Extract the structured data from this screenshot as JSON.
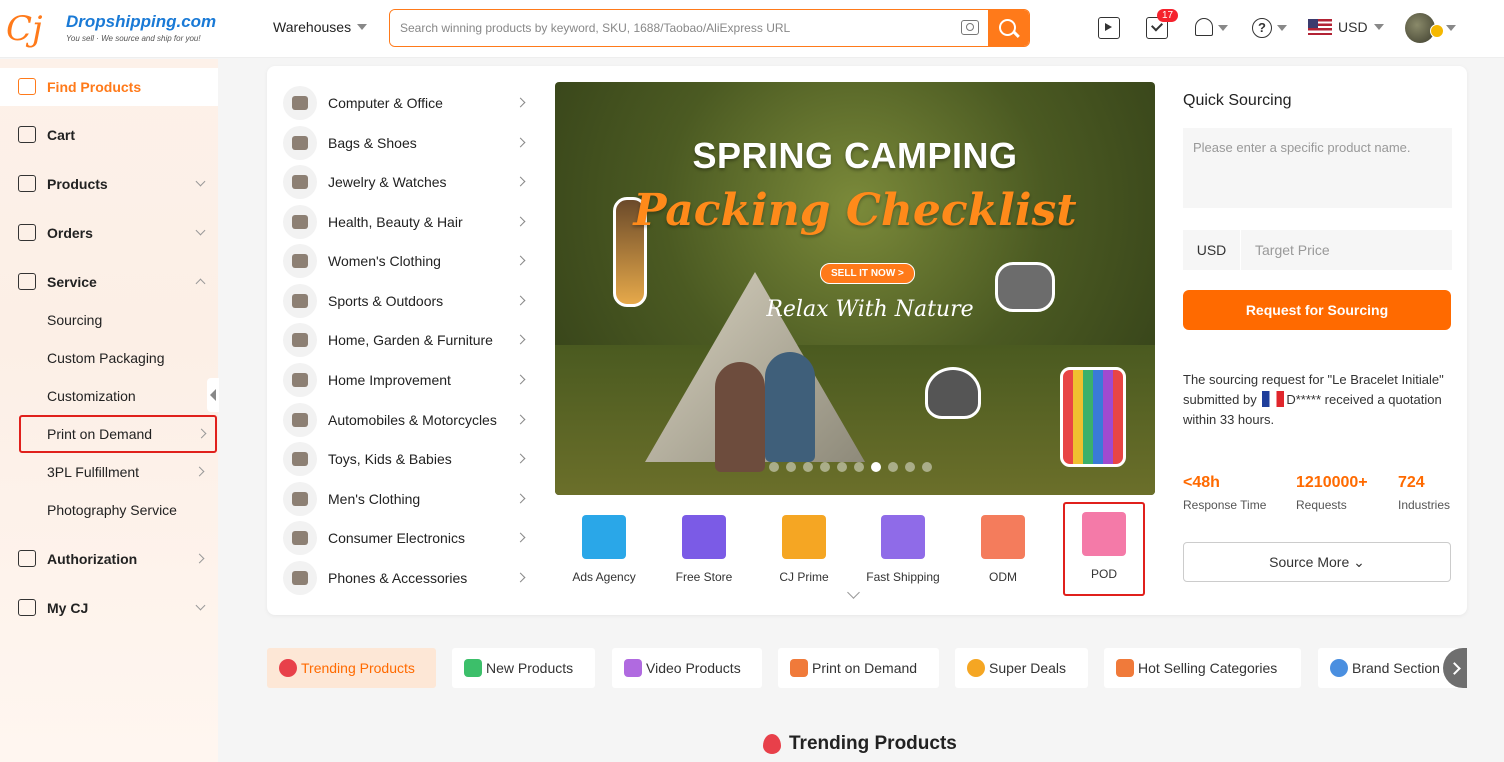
{
  "header": {
    "logo_name": "Dropshipping.com",
    "logo_tagline": "You sell · We source and ship for you!",
    "warehouses_label": "Warehouses",
    "search_placeholder": "Search winning products by keyword, SKU, 1688/Taobao/AliExpress URL",
    "tasks_badge": "17",
    "currency": "USD",
    "accent_color": "#ff7a1a"
  },
  "sidebar": {
    "find_products": "Find Products",
    "cart": "Cart",
    "products": "Products",
    "orders": "Orders",
    "service": "Service",
    "service_items": [
      "Sourcing",
      "Custom Packaging",
      "Customization",
      "Print on Demand",
      "3PL Fulfillment",
      "Photography Service"
    ],
    "authorization": "Authorization",
    "my_cj": "My CJ"
  },
  "categories": [
    "Computer & Office",
    "Bags & Shoes",
    "Jewelry & Watches",
    "Health, Beauty & Hair",
    "Women's Clothing",
    "Sports & Outdoors",
    "Home, Garden & Furniture",
    "Home Improvement",
    "Automobiles & Motorcycles",
    "Toys, Kids & Babies",
    "Men's Clothing",
    "Consumer Electronics",
    "Phones & Accessories"
  ],
  "banner": {
    "title": "SPRING CAMPING",
    "script": "Packing Checklist",
    "cta": "SELL IT NOW >",
    "subtitle": "Relax With Nature",
    "slide_count": 10,
    "active_slide": 7
  },
  "features": [
    {
      "label": "Ads Agency",
      "color": "#2aa7e8"
    },
    {
      "label": "Free Store",
      "color": "#7b5be6"
    },
    {
      "label": "CJ Prime",
      "color": "#f5a623"
    },
    {
      "label": "Fast Shipping",
      "color": "#8f6be8"
    },
    {
      "label": "ODM",
      "color": "#f47c5c"
    },
    {
      "label": "POD",
      "color": "#f47aa8"
    }
  ],
  "quick_sourcing": {
    "title": "Quick Sourcing",
    "product_placeholder": "Please enter a specific product name.",
    "currency": "USD",
    "price_placeholder": "Target Price",
    "request_button": "Request for Sourcing",
    "note_prefix": "The sourcing request for \"Le Bracelet Initiale\" submitted by",
    "note_user": "D*****",
    "note_suffix": "received a quotation within 33 hours.",
    "stats": [
      {
        "value": "<48h",
        "label": "Response Time"
      },
      {
        "value": "1210000+",
        "label": "Requests"
      },
      {
        "value": "724",
        "label": "Industries"
      }
    ],
    "source_more": "Source More"
  },
  "product_tabs": [
    {
      "label": "Trending Products",
      "color": "#e8404a"
    },
    {
      "label": "New Products",
      "color": "#3cbf6a"
    },
    {
      "label": "Video Products",
      "color": "#b06ae0"
    },
    {
      "label": "Print on Demand",
      "color": "#f07a3a"
    },
    {
      "label": "Super Deals",
      "color": "#f5a623"
    },
    {
      "label": "Hot Selling Categories",
      "color": "#f07a3a"
    },
    {
      "label": "Brand Section",
      "color": "#4a8fe0"
    }
  ],
  "section_title": "Trending Products"
}
